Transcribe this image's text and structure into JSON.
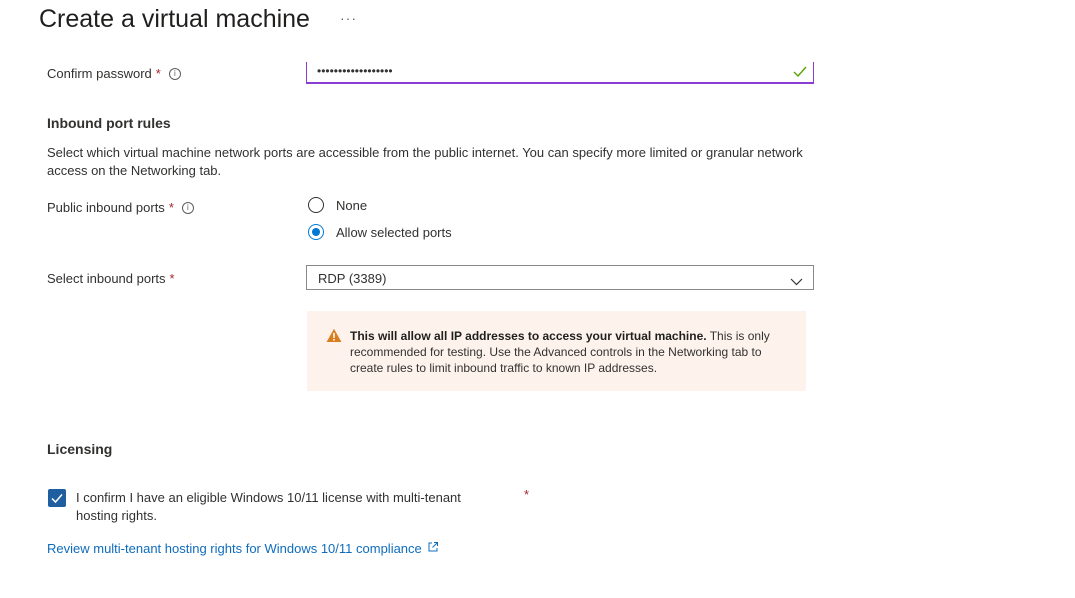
{
  "header": {
    "title": "Create a virtual machine",
    "more_label": "···"
  },
  "confirm_password": {
    "label": "Confirm password",
    "required_mark": "*",
    "info_glyph": "i",
    "value": "••••••••••••••••••",
    "valid": true
  },
  "inbound_port_rules": {
    "heading": "Inbound port rules",
    "description": "Select which virtual machine network ports are accessible from the public internet. You can specify more limited or granular network access on the Networking tab.",
    "public_inbound_ports": {
      "label": "Public inbound ports",
      "required_mark": "*",
      "info_glyph": "i",
      "options": [
        "None",
        "Allow selected ports"
      ],
      "selected": "Allow selected ports"
    },
    "select_inbound_ports": {
      "label": "Select inbound ports",
      "required_mark": "*",
      "value": "RDP (3389)"
    },
    "warning": {
      "bold": "This will allow all IP addresses to access your virtual machine.",
      "text": " This is only recommended for testing.  Use the Advanced controls in the Networking tab to create rules to limit inbound traffic to known IP addresses."
    }
  },
  "licensing": {
    "heading": "Licensing",
    "checkbox_label": "I confirm I have an eligible Windows 10/11 license with multi-tenant hosting rights.",
    "checked": true,
    "required_mark": "*",
    "link_text": "Review multi-tenant hosting rights for Windows 10/11 compliance"
  },
  "colors": {
    "accent": "#0078d4",
    "link": "#0f6cbd",
    "focus_border": "#8a3bd1",
    "valid_check": "#57a300",
    "warning_icon": "#d97e1f",
    "warning_bg": "#fdf3ec",
    "required": "#a4262c"
  },
  "icons": {
    "valid": "checkmark-icon",
    "info": "info-icon",
    "dropdown": "chevron-down-icon",
    "warning": "warning-icon",
    "external_link": "external-link-icon"
  }
}
